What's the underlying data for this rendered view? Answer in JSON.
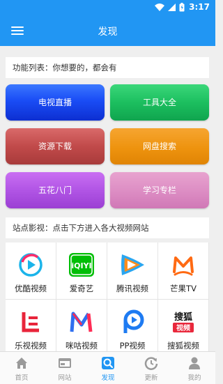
{
  "status_bar": {
    "time": "3:17"
  },
  "app_bar": {
    "title": "发现",
    "menu_icon": "hamburger-menu-icon"
  },
  "function_section": {
    "label": "功能列表：你想要的，都会有"
  },
  "function_buttons": [
    {
      "label": "电视直播",
      "color": "#1a4cf5"
    },
    {
      "label": "工具大全",
      "color": "#1cbf5f"
    },
    {
      "label": "资源下载",
      "color": "#c14a4a"
    },
    {
      "label": "网盘搜索",
      "color": "#ee930e"
    },
    {
      "label": "五花八门",
      "color": "#b155e5"
    },
    {
      "label": "学习专栏",
      "color": "#dc8cc3"
    }
  ],
  "sites_section": {
    "label": "站点影视：点击下方进入各大视频网站"
  },
  "sites": [
    {
      "name": "优酷视频",
      "icon": "youku-logo-icon"
    },
    {
      "name": "爱奇艺",
      "icon": "iqiyi-logo-icon"
    },
    {
      "name": "腾讯视频",
      "icon": "tencent-video-logo-icon"
    },
    {
      "name": "芒果TV",
      "icon": "mango-tv-logo-icon"
    },
    {
      "name": "乐视视频",
      "icon": "letv-logo-icon"
    },
    {
      "name": "咪咕视频",
      "icon": "migu-logo-icon"
    },
    {
      "name": "PP视频",
      "icon": "pp-video-logo-icon"
    },
    {
      "name": "搜狐视频",
      "icon": "sohu-video-logo-icon",
      "logo_text_top": "搜狐",
      "logo_text_bottom": "视频"
    }
  ],
  "bottom_nav": [
    {
      "label": "首页",
      "icon": "home-icon",
      "active": false
    },
    {
      "label": "网站",
      "icon": "website-icon",
      "active": false
    },
    {
      "label": "发现",
      "icon": "discover-search-icon",
      "active": true
    },
    {
      "label": "更新",
      "icon": "update-icon",
      "active": false
    },
    {
      "label": "我的",
      "icon": "profile-icon",
      "active": false
    }
  ],
  "colors": {
    "primary": "#2196f3",
    "background": "#efefef"
  }
}
